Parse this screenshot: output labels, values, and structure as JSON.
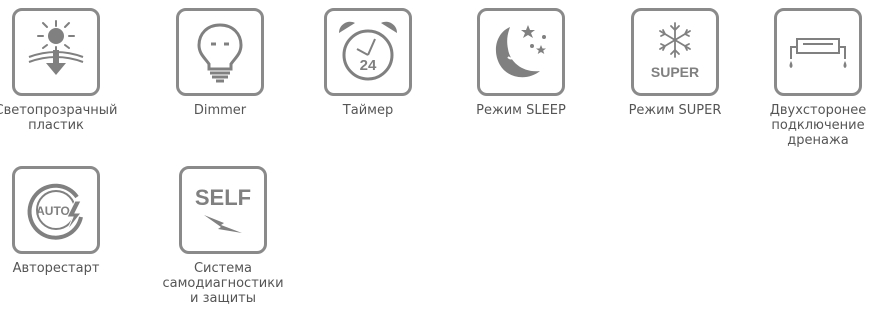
{
  "features": [
    {
      "icon": "sun-icon",
      "label_lines": [
        "Светопрозрачный",
        "пластик"
      ]
    },
    {
      "icon": "dimmer-bulb-icon",
      "label_lines": [
        "Dimmer"
      ]
    },
    {
      "icon": "alarm-clock-icon",
      "label_lines": [
        "Таймер"
      ],
      "icon_text": "24"
    },
    {
      "icon": "moon-stars-icon",
      "label_lines": [
        "Режим SLEEP"
      ]
    },
    {
      "icon": "snowflake-icon",
      "label_lines": [
        "Режим SUPER"
      ],
      "icon_text": "SUPER"
    },
    {
      "icon": "drain-icon",
      "label_lines": [
        "Двухсторонее",
        "подключение",
        "дренажа"
      ]
    },
    {
      "icon": "autorestart-icon",
      "label_lines": [
        "Авторестарт"
      ],
      "icon_text": "AUTO"
    },
    {
      "icon": "self-diagnostics-icon",
      "label_lines": [
        "Система",
        "самодиагностики",
        "и защиты"
      ],
      "icon_text": "SELF"
    }
  ],
  "colors": {
    "icon_stroke": "#8a8a8a",
    "icon_fill": "#808080",
    "label_text": "#555555"
  }
}
